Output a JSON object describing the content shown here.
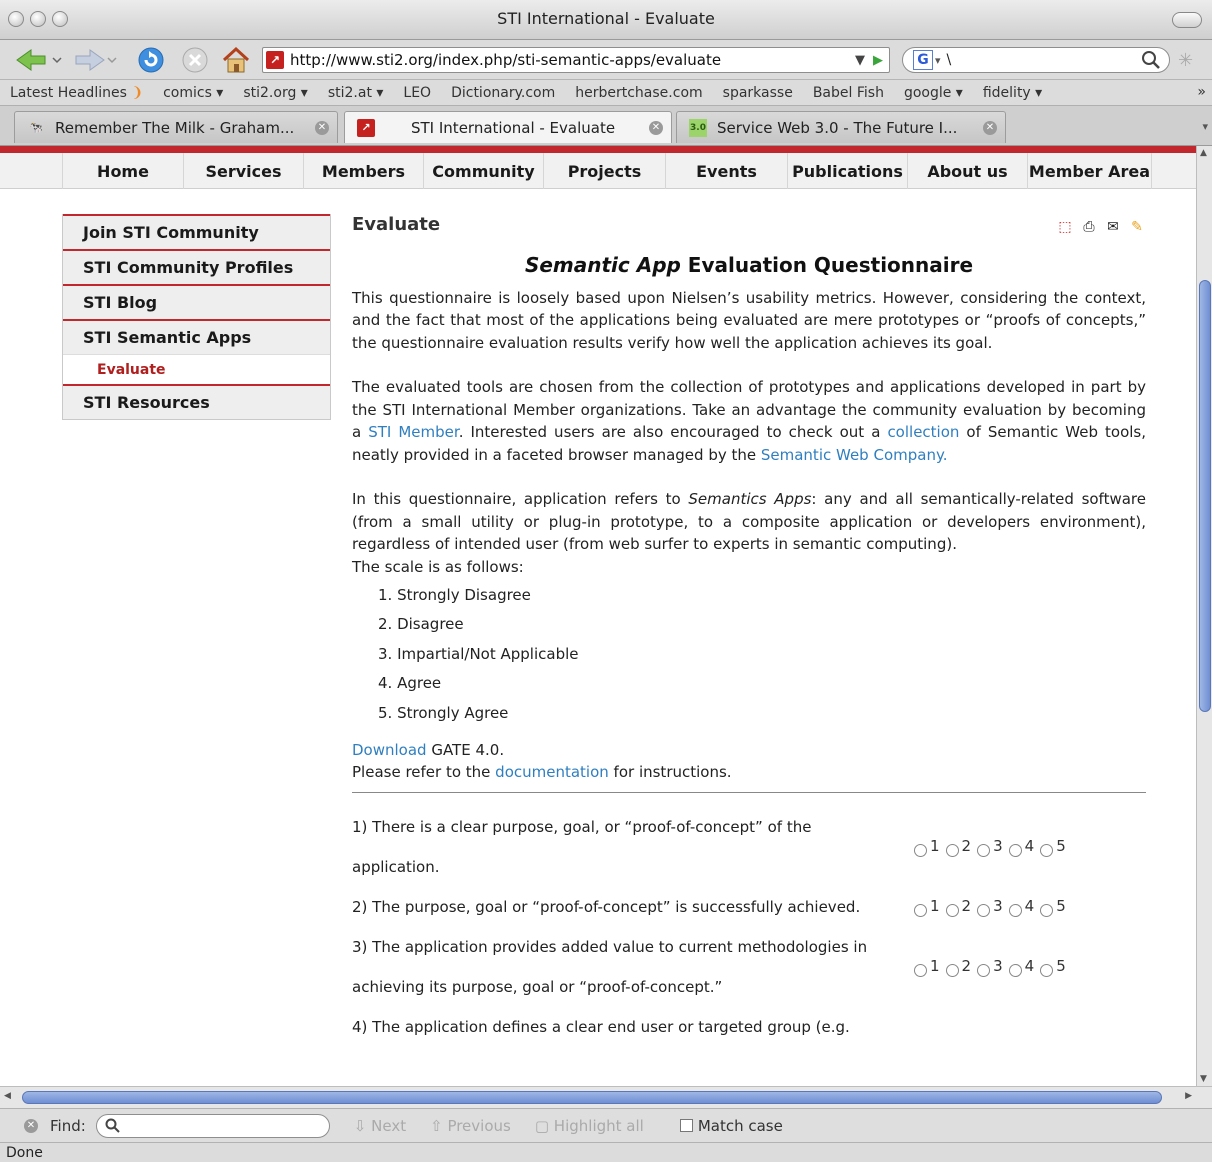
{
  "window": {
    "title": "STI International - Evaluate"
  },
  "toolbar": {
    "url": "http://www.sti2.org/index.php/sti-semantic-apps/evaluate",
    "search_value": "\\"
  },
  "bookmarks": [
    "Latest Headlines",
    "comics ▾",
    "sti2.org ▾",
    "sti2.at ▾",
    "LEO",
    "Dictionary.com",
    "herbertchase.com",
    "sparkasse",
    "Babel Fish",
    "google ▾",
    "fidelity ▾"
  ],
  "tabs": [
    {
      "label": "Remember The Milk - Graham..."
    },
    {
      "label": "STI International - Evaluate"
    },
    {
      "label": "Service Web 3.0 - The Future I..."
    }
  ],
  "menu": [
    "Home",
    "Services",
    "Members",
    "Community",
    "Projects",
    "Events",
    "Publications",
    "About us",
    "Member Area"
  ],
  "sidebar": {
    "items": [
      "Join STI Community",
      "STI Community Profiles",
      "STI Blog",
      "STI Semantic Apps"
    ],
    "sub_item": "Evaluate",
    "last_item": "STI Resources"
  },
  "content": {
    "title": "Evaluate",
    "heading_italic": "Semantic App",
    "heading_rest": " Evaluation Questionnaire",
    "p1": "This questionnaire is loosely based upon Nielsen’s usability metrics. However, considering the context, and the fact that most of the applications being evaluated are mere prototypes or “proofs of concepts,” the questionnaire evaluation results verify how well the application achieves its goal.",
    "p2_a": "The evaluated tools are chosen from the collection of prototypes and applications developed in part by the STI International Member organizations. Take an advantage the community evaluation by becoming a ",
    "p2_link1": "STI Member",
    "p2_b": ". Interested users are also encouraged to check out a ",
    "p2_link2": "collection",
    "p2_c": " of Semantic Web tools, neatly provided in a faceted browser managed by the ",
    "p2_link3": "Semantic Web Company.",
    "p3_a": "In this questionnaire, application refers to ",
    "p3_italic": "Semantics Apps",
    "p3_b": ": any and all semantically-related software (from a small utility or plug-in prototype, to a composite application or developers environment), regardless of intended user (from web surfer to experts in semantic computing).",
    "p3_c": "The scale is as follows:",
    "scale": [
      "1.  Strongly Disagree",
      "2.  Disagree",
      "3.  Impartial/Not Applicable",
      "4.  Agree",
      "5.  Strongly Agree"
    ],
    "download_link": "Download",
    "download_rest": " GATE 4.0.",
    "refer_a": "Please refer to the ",
    "refer_link": "documentation",
    "refer_b": " for instructions.",
    "questions": [
      "1) There is a clear purpose, goal, or “proof-of-concept” of the application.",
      "2) The purpose, goal or “proof-of-concept” is successfully achieved.",
      "3) The application provides added value to current methodologies in achieving its purpose, goal or “proof-of-concept.”",
      "4) The application defines a clear end user or targeted group (e.g."
    ],
    "radio_labels": [
      "1",
      "2",
      "3",
      "4",
      "5"
    ]
  },
  "findbar": {
    "label": "Find:",
    "next": "Next",
    "previous": "Previous",
    "highlight": "Highlight all",
    "match_case": "Match case"
  },
  "status": "Done"
}
